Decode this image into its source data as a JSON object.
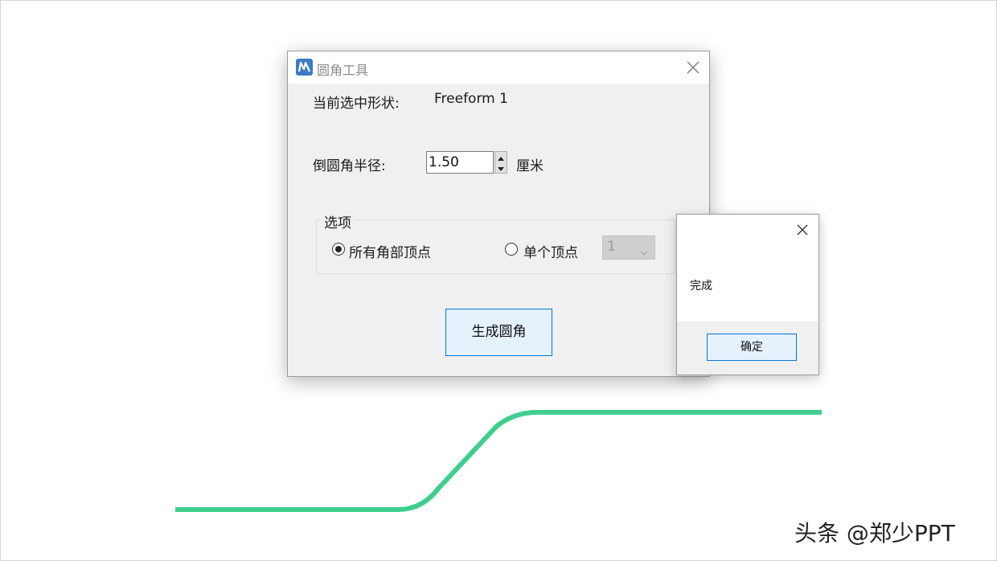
{
  "dialog": {
    "title": "圆角工具",
    "current_shape_label": "当前选中形状:",
    "current_shape_value": "Freeform 1",
    "radius_label": "倒圆角半径:",
    "radius_value": "1.50",
    "radius_unit": "厘米",
    "options_legend": "选项",
    "option_all_label": "所有角部顶点",
    "option_single_label": "单个顶点",
    "option_selected": "all",
    "vertex_combo_value": "1",
    "generate_button": "生成圆角",
    "app_icon": "app-logo-icon",
    "close_icon": "close-icon"
  },
  "message_box": {
    "message": "完成",
    "ok_button": "确定",
    "close_icon": "close-icon"
  },
  "watermark": "头条 @郑少PPT",
  "colors": {
    "curve": "#3ecf8e",
    "accent_blue": "#0078d7",
    "button_bg": "#e5f1fb",
    "dialog_bg": "#f0f0f0"
  }
}
